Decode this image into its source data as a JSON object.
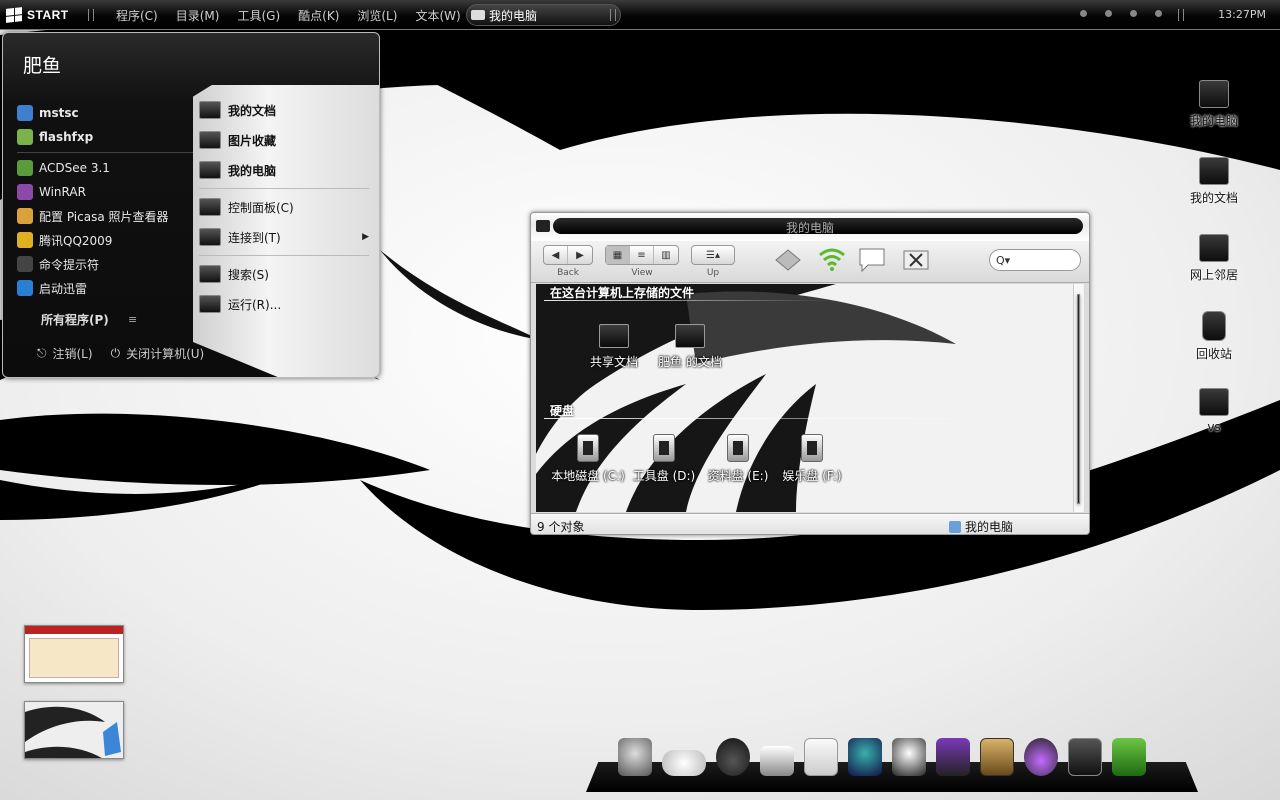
{
  "topbar": {
    "start_label": "START",
    "menu": [
      "程序(C)",
      "目录(M)",
      "工具(G)",
      "酷点(K)",
      "浏览(L)",
      "文本(W)"
    ],
    "task_button": "我的电脑",
    "clock": "13:27PM"
  },
  "start_menu": {
    "user": "肥鱼",
    "pinned": [
      {
        "label": "mstsc",
        "icon": "remote-desktop-icon",
        "color": "#3f7fcf"
      },
      {
        "label": "flashfxp",
        "icon": "ftp-icon",
        "color": "#7bb24c"
      }
    ],
    "recent": [
      {
        "label": "ACDSee 3.1",
        "icon": "acdsee-icon",
        "color": "#5a9c3c"
      },
      {
        "label": "WinRAR",
        "icon": "winrar-icon",
        "color": "#8a4aa8"
      },
      {
        "label": "配置 Picasa 照片查看器",
        "icon": "picasa-icon",
        "color": "#d8a13a"
      },
      {
        "label": "腾讯QQ2009",
        "icon": "qq-icon",
        "color": "#e0b020"
      },
      {
        "label": "命令提示符",
        "icon": "cmd-icon",
        "color": "#444444"
      },
      {
        "label": "启动迅雷",
        "icon": "thunder-icon",
        "color": "#2a7fd4"
      }
    ],
    "all_programs": "所有程序(P)",
    "logoff": "注销(L)",
    "shutdown": "关闭计算机(U)",
    "places": [
      {
        "label": "我的文档",
        "bold": true
      },
      {
        "label": "图片收藏",
        "bold": true
      },
      {
        "label": "我的电脑",
        "bold": true
      },
      {
        "label": "控制面板(C)",
        "bold": false
      },
      {
        "label": "连接到(T)",
        "bold": false,
        "submenu": true
      },
      {
        "label": "搜索(S)",
        "bold": false
      },
      {
        "label": "运行(R)...",
        "bold": false
      }
    ]
  },
  "desktop_icons": [
    {
      "label": "我的电脑",
      "icon": "computer-icon"
    },
    {
      "label": "我的文档",
      "icon": "documents-icon"
    },
    {
      "label": "网上邻居",
      "icon": "network-icon"
    },
    {
      "label": "回收站",
      "icon": "recycle-bin-icon"
    },
    {
      "label": "vs",
      "icon": "folder-icon"
    }
  ],
  "explorer": {
    "title": "我的电脑",
    "toolbar": {
      "back": "Back",
      "view": "View",
      "up": "Up",
      "search_glyph": "Q▾"
    },
    "sections": [
      {
        "title": "在这台计算机上存储的文件",
        "items": [
          {
            "label": "共享文档",
            "icon": "folder-icon"
          },
          {
            "label": "肥鱼 的文档",
            "icon": "folder-icon"
          }
        ]
      },
      {
        "title": "硬盘",
        "items": [
          {
            "label": "本地磁盘 (C:)",
            "icon": "drive-icon"
          },
          {
            "label": "工具盘 (D:)",
            "icon": "drive-icon"
          },
          {
            "label": "资料盘 (E:)",
            "icon": "drive-icon"
          },
          {
            "label": "娱乐盘 (F:)",
            "icon": "drive-icon"
          }
        ]
      }
    ],
    "status_left": "9 个对象",
    "status_right": "我的电脑"
  },
  "dock": {
    "items": [
      "ghost-icon",
      "cloud-icon",
      "hat-icon",
      "sneaker-icon",
      "notepad-icon",
      "penguin-icon",
      "qq-icon",
      "magic-hat-icon",
      "disk-utility-icon",
      "headphones-icon",
      "package-icon",
      "cat-icon"
    ]
  },
  "colors": {
    "accent": "#000000",
    "panel": "#dcdcdc"
  }
}
